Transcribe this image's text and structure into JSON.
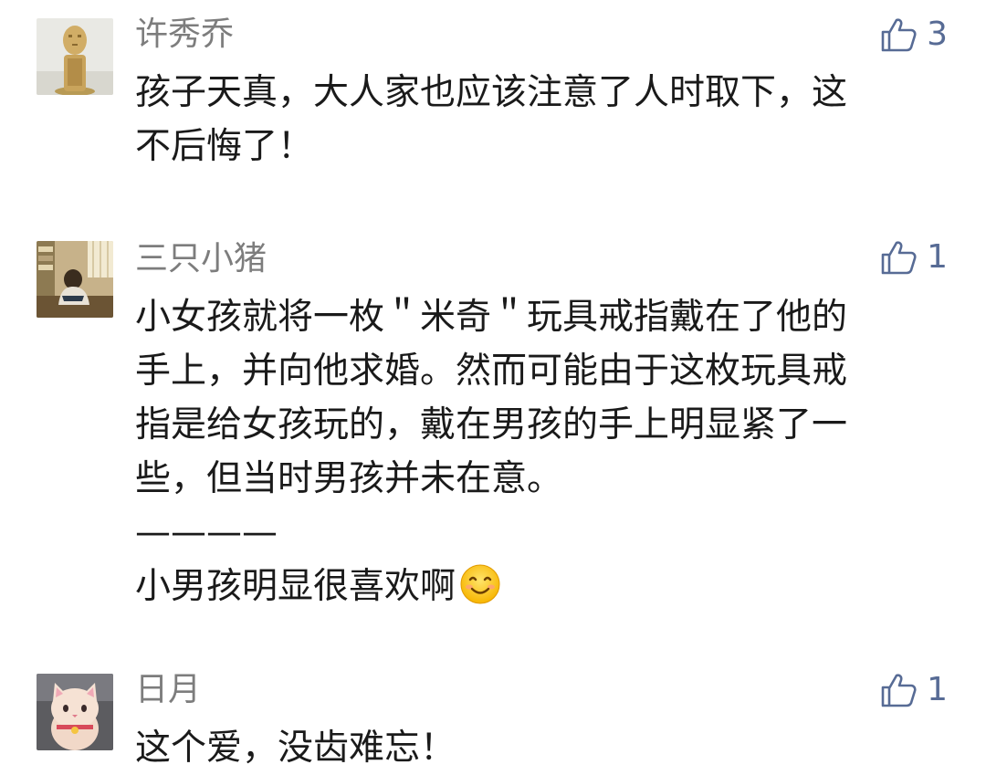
{
  "comments": [
    {
      "nickname": "许秀乔",
      "likes": "3",
      "avatar_icon": "wooden-figure-avatar",
      "lines": [
        "孩子天真，大人家也应该注意了人时取下，这",
        "不后悔了！"
      ]
    },
    {
      "nickname": "三只小猪",
      "likes": "1",
      "avatar_icon": "person-room-avatar",
      "lines": [
        "小女孩就将一枚＂米奇＂玩具戒指戴在了他的",
        "手上，并向他求婚。然而可能由于这枚玩具戒",
        "指是给女孩玩的，戴在男孩的手上明显紧了一",
        "些，但当时男孩并未在意。",
        "————",
        "小男孩明显很喜欢啊"
      ],
      "emoji": "smiling-face-emoji"
    },
    {
      "nickname": "日月",
      "likes": "1",
      "avatar_icon": "lucky-cat-avatar",
      "lines": [
        "这个爱，没齿难忘！"
      ]
    }
  ],
  "colors": {
    "nickname": "#7d7d7d",
    "like_accent": "#576b95",
    "text": "#1a1a1a"
  },
  "icons": {
    "like": "thumbs-up-icon"
  }
}
